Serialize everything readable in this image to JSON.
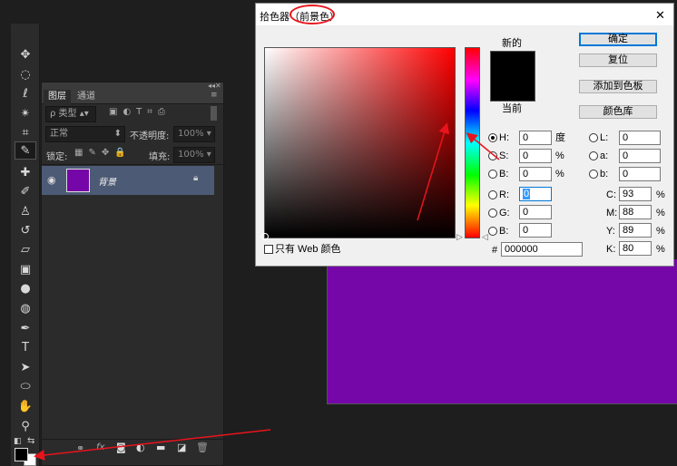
{
  "dialog": {
    "title": "拾色器（",
    "title_target": "前景色",
    "title_end": "）",
    "close": "✕",
    "new_label": "新的",
    "current_label": "当前",
    "new_color": "#000000",
    "current_color": "#000000",
    "buttons": {
      "ok": "确定",
      "reset": "复位",
      "add_swatch": "添加到色板",
      "libraries": "颜色库"
    },
    "web_only": "只有 Web 颜色",
    "hsb": [
      {
        "key": "H:",
        "value": "0",
        "unit": "度",
        "selected": true
      },
      {
        "key": "S:",
        "value": "0",
        "unit": "%",
        "selected": false
      },
      {
        "key": "B:",
        "value": "0",
        "unit": "%",
        "selected": false
      }
    ],
    "rgb": [
      {
        "key": "R:",
        "value": "0"
      },
      {
        "key": "G:",
        "value": "0"
      },
      {
        "key": "B:",
        "value": "0"
      }
    ],
    "lab": [
      {
        "key": "L:",
        "value": "0"
      },
      {
        "key": "a:",
        "value": "0"
      },
      {
        "key": "b:",
        "value": "0"
      }
    ],
    "cmyk": [
      {
        "key": "C:",
        "value": "93",
        "unit": "%"
      },
      {
        "key": "M:",
        "value": "88",
        "unit": "%"
      },
      {
        "key": "Y:",
        "value": "89",
        "unit": "%"
      },
      {
        "key": "K:",
        "value": "80",
        "unit": "%"
      }
    ],
    "hex_label": "#",
    "hex": "000000"
  },
  "layers": {
    "tabs": [
      "图层",
      "通道"
    ],
    "filter_kind": "ρ 类型",
    "blend_mode": "正常",
    "opacity_label": "不透明度:",
    "opacity": "100%",
    "lock_label": "锁定:",
    "fill_label": "填充:",
    "fill": "100%",
    "layer_name": "背景",
    "layer_color": "#7506a8"
  },
  "canvas": {
    "color": "#7506a8"
  },
  "colors": {
    "accent": "#0078d7",
    "annotation": "#e8141b"
  }
}
